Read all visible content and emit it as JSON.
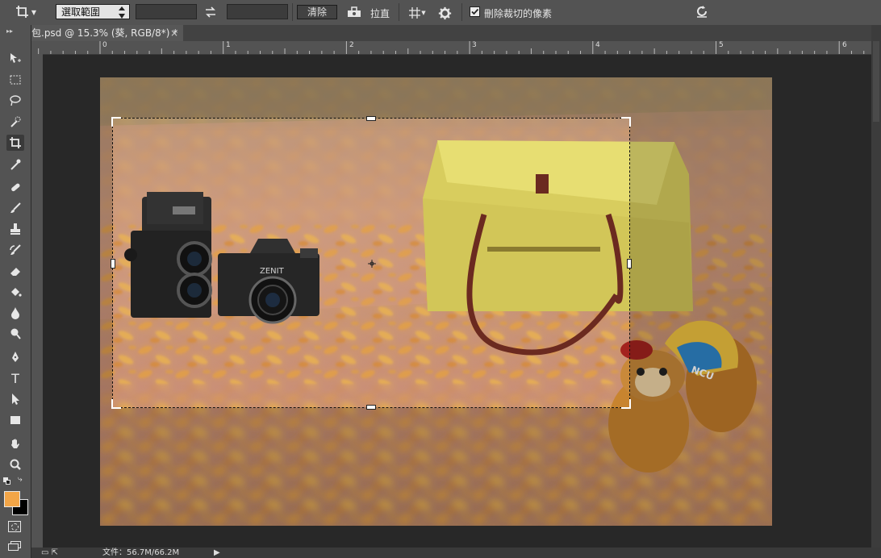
{
  "options_bar": {
    "crop_icon": "crop-icon",
    "ratio_select_value": "選取範圍",
    "width_value": "",
    "height_value": "",
    "swap_icon": "swap-arrows-icon",
    "clear_label": "清除",
    "straighten_icon": "level-icon",
    "straighten_label": "拉直",
    "grid_icon": "grid-overlay-icon",
    "settings_icon": "gear-icon",
    "delete_cropped_label": "刪除裁切的像素",
    "delete_cropped_checked": true,
    "reset_icon": "reset-icon"
  },
  "document_tab": {
    "title": "包.psd @ 15.3% (葵, RGB/8*) *",
    "close_glyph": "×"
  },
  "ruler": {
    "ticks": [
      "0",
      "1",
      "2",
      "3",
      "4",
      "5",
      "6"
    ]
  },
  "tools": [
    {
      "name": "move-tool",
      "icon": "move-icon"
    },
    {
      "name": "marquee-tool",
      "icon": "rect-marquee-icon"
    },
    {
      "name": "lasso-tool",
      "icon": "lasso-icon"
    },
    {
      "name": "quick-select-tool",
      "icon": "quick-select-icon"
    },
    {
      "name": "crop-tool",
      "icon": "crop-icon",
      "active": true
    },
    {
      "name": "eyedropper-tool",
      "icon": "eyedropper-icon"
    },
    {
      "name": "healing-tool",
      "icon": "bandage-icon"
    },
    {
      "name": "brush-tool",
      "icon": "brush-icon"
    },
    {
      "name": "stamp-tool",
      "icon": "stamp-icon"
    },
    {
      "name": "history-brush-tool",
      "icon": "history-brush-icon"
    },
    {
      "name": "eraser-tool",
      "icon": "eraser-icon"
    },
    {
      "name": "bucket-tool",
      "icon": "paint-bucket-icon"
    },
    {
      "name": "blur-tool",
      "icon": "drop-icon"
    },
    {
      "name": "dodge-tool",
      "icon": "dodge-icon"
    },
    {
      "name": "pen-tool",
      "icon": "pen-icon"
    },
    {
      "name": "type-tool",
      "icon": "type-icon"
    },
    {
      "name": "path-select-tool",
      "icon": "arrow-icon"
    },
    {
      "name": "shape-tool",
      "icon": "rectangle-icon"
    },
    {
      "name": "hand-tool",
      "icon": "hand-icon"
    },
    {
      "name": "zoom-tool",
      "icon": "zoom-icon"
    }
  ],
  "colors": {
    "foreground": "#f2a547",
    "background": "#000000"
  },
  "status": {
    "doc_size": "文件：56.7M/66.2M"
  },
  "image": {
    "bag_text": "NCU",
    "camera_brand": "ZENIT"
  }
}
